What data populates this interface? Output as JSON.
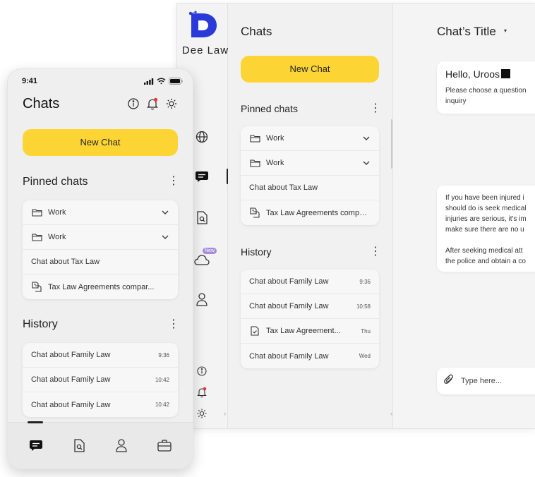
{
  "desktop": {
    "logo_text": "Dee Law",
    "chats_title": "Chats",
    "new_chat_label": "New Chat",
    "pinned_title": "Pinned chats",
    "pinned": [
      {
        "label": "Work",
        "icon": "folder-icon",
        "expandable": true
      },
      {
        "label": "Work",
        "icon": "folder-icon",
        "expandable": true
      },
      {
        "label": "Chat about Tax Law",
        "icon": "",
        "expandable": false
      },
      {
        "label": "Tax Law Agreements compar...",
        "icon": "document-compare-icon",
        "expandable": false
      }
    ],
    "history_title": "History",
    "history": [
      {
        "label": "Chat about Family Law",
        "time": "9:36"
      },
      {
        "label": "Chat about Family Law",
        "time": "10:58"
      },
      {
        "label": "Tax Law Agreement...",
        "time": "Thu",
        "icon": "document-check-icon"
      },
      {
        "label": "Chat about Family Law",
        "time": "Wed"
      }
    ],
    "new_badge": "New",
    "chat_title": "Chat’s Title",
    "greeting": "Hello, Uroos",
    "greeting_text": "Please choose a question\ninquiry",
    "answer_text": "If you have been injured i\nshould do is seek medical\ninjuries are serious, it's im\nmake sure there are no u\n\nAfter seeking medical att\nthe police and obtain a co",
    "input_placeholder": "Type here..."
  },
  "phone": {
    "time": "9:41",
    "title": "Chats",
    "new_chat_label": "New Chat",
    "pinned_title": "Pinned chats",
    "pinned": [
      {
        "label": "Work",
        "icon": "folder-icon",
        "expandable": true
      },
      {
        "label": "Work",
        "icon": "folder-icon",
        "expandable": true
      },
      {
        "label": "Chat about Tax Law",
        "icon": "",
        "expandable": false
      },
      {
        "label": "Tax Law Agreements compar...",
        "icon": "document-compare-icon",
        "expandable": false
      }
    ],
    "history_title": "History",
    "history": [
      {
        "label": "Chat about Family Law",
        "time": "9:36"
      },
      {
        "label": "Chat about Family Law",
        "time": "10:42"
      },
      {
        "label": "Chat about Family Law",
        "time": "10:42"
      }
    ]
  },
  "colors": {
    "accent_yellow": "#fcd535",
    "brand_blue": "#2a3ad8",
    "notification_red": "#e53935",
    "badge_purple": "#a78bdb"
  }
}
